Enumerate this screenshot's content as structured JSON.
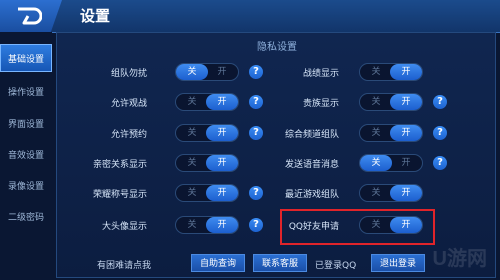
{
  "header": {
    "title": "设置"
  },
  "sidebar": {
    "items": [
      {
        "label": "基础设置",
        "active": true
      },
      {
        "label": "操作设置",
        "active": false
      },
      {
        "label": "界面设置",
        "active": false
      },
      {
        "label": "音效设置",
        "active": false
      },
      {
        "label": "录像设置",
        "active": false
      },
      {
        "label": "二级密码",
        "active": false
      }
    ]
  },
  "privacy": {
    "section_title": "隐私设置",
    "off_label": "关",
    "on_label": "开",
    "help_label": "?",
    "left": [
      {
        "label": "组队勿扰",
        "value": "off",
        "help": true
      },
      {
        "label": "允许观战",
        "value": "on",
        "help": true
      },
      {
        "label": "允许预约",
        "value": "on",
        "help": true
      },
      {
        "label": "亲密关系显示",
        "value": "on",
        "help": false
      },
      {
        "label": "荣耀称号显示",
        "value": "on",
        "help": true
      },
      {
        "label": "大头像显示",
        "value": "on",
        "help": true
      }
    ],
    "right": [
      {
        "label": "战绩显示",
        "value": "on",
        "help": false
      },
      {
        "label": "贵族显示",
        "value": "on",
        "help": true
      },
      {
        "label": "综合频道组队",
        "value": "on",
        "help": true
      },
      {
        "label": "发送语音消息",
        "value": "off",
        "help": true
      },
      {
        "label": "最近游戏组队",
        "value": "on",
        "help": false
      },
      {
        "label": "QQ好友申请",
        "value": "on",
        "help": false
      }
    ]
  },
  "footer": {
    "question_text": "有困难请点我",
    "self_service_button": "自助查询",
    "contact_button": "联系客服",
    "login_status": "已登录QQ",
    "logout_button": "退出登录"
  },
  "watermark": "U游网"
}
